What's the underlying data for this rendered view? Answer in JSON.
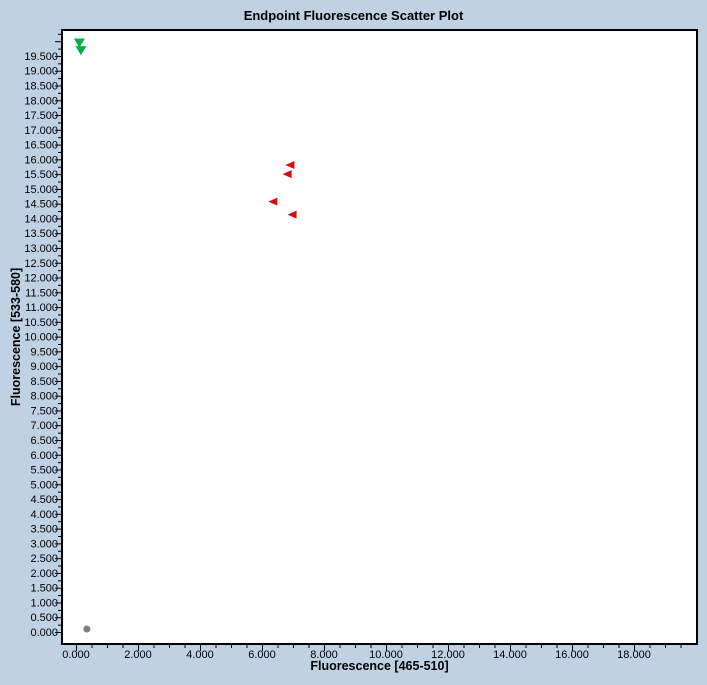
{
  "chart_data": {
    "type": "scatter",
    "title": "Endpoint Fluorescence Scatter Plot",
    "xlabel": "Fluorescence [465-510]",
    "ylabel": "Fluorescence [533-580]",
    "xlim": [
      -0.45,
      20.05
    ],
    "ylim": [
      -0.4,
      20.35
    ],
    "grid": false,
    "legend": "none",
    "x_tick_step_major": 2.0,
    "x_tick_step_minor": 0.5,
    "y_tick_step_major": 0.5,
    "y_tick_step_minor": 0.25,
    "x_tick_labels": [
      "0.000",
      "2.000",
      "4.000",
      "6.000",
      "8.000",
      "10.000",
      "12.000",
      "14.000",
      "16.000",
      "18.000"
    ],
    "y_tick_labels": [
      "0.000",
      "0.500",
      "1.000",
      "1.500",
      "2.000",
      "2.500",
      "3.000",
      "3.500",
      "4.000",
      "4.500",
      "5.000",
      "5.500",
      "6.000",
      "6.500",
      "7.000",
      "7.500",
      "8.000",
      "8.500",
      "9.000",
      "9.500",
      "10.000",
      "10.500",
      "11.000",
      "11.500",
      "12.000",
      "12.500",
      "13.000",
      "13.500",
      "14.000",
      "14.500",
      "15.000",
      "15.500",
      "16.000",
      "16.500",
      "17.000",
      "17.500",
      "18.000",
      "18.500",
      "19.000",
      "19.500"
    ],
    "page_background": "#BFD2E4",
    "plot_background": "#FFFFFF",
    "border_color": "#000000",
    "tick_color": "#000000",
    "text_color": "#000000",
    "series": [
      {
        "name": "green-down-triangles",
        "marker": "triangle-down",
        "color": "#00B143",
        "points": [
          [
            0.11,
            19.94
          ],
          [
            0.16,
            19.68
          ]
        ]
      },
      {
        "name": "red-left-triangles",
        "marker": "triangle-left",
        "color": "#DC0A0A",
        "points": [
          [
            6.9,
            15.81
          ],
          [
            6.81,
            15.5
          ],
          [
            6.35,
            14.57
          ],
          [
            6.97,
            14.13
          ]
        ]
      },
      {
        "name": "gray-circle",
        "marker": "circle",
        "color": "#7F7F7F",
        "points": [
          [
            0.35,
            0.1
          ]
        ]
      }
    ]
  }
}
